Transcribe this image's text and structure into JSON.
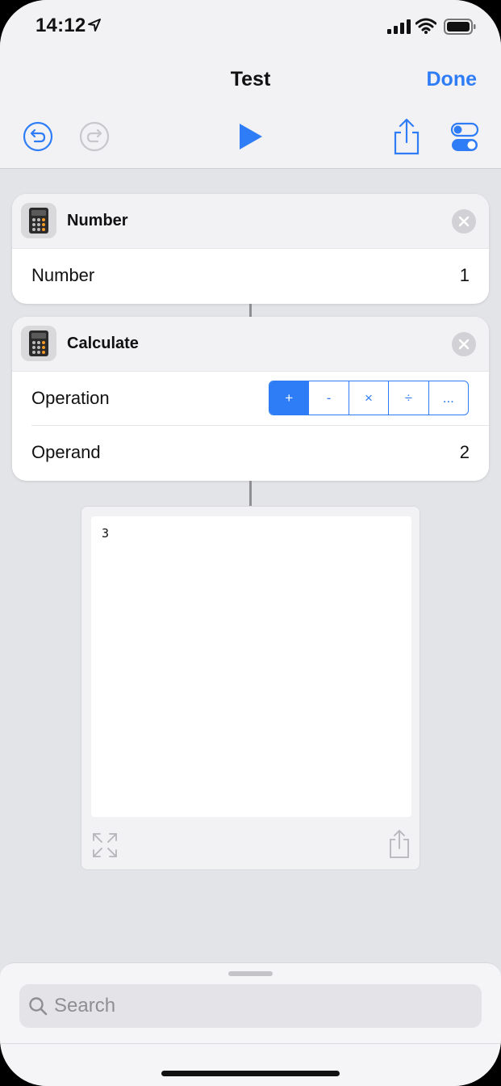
{
  "status_bar": {
    "time": "14:12"
  },
  "nav": {
    "title": "Test",
    "done_label": "Done"
  },
  "toolbar": {
    "icons": [
      "undo-icon",
      "redo-icon",
      "play-icon",
      "share-icon",
      "settings-toggle-icon"
    ]
  },
  "actions": [
    {
      "title": "Number",
      "icon": "calculator-icon",
      "rows": [
        {
          "label": "Number",
          "value": "1"
        }
      ]
    },
    {
      "title": "Calculate",
      "icon": "calculator-icon",
      "operation_label": "Operation",
      "operations": [
        "+",
        "-",
        "×",
        "÷",
        "..."
      ],
      "selected_operation": "+",
      "operand_label": "Operand",
      "operand_value": "2"
    }
  ],
  "result": {
    "text": "3"
  },
  "search": {
    "placeholder": "Search"
  },
  "colors": {
    "accent": "#2f7df6",
    "background": "#e3e4e7",
    "card": "#ffffff"
  }
}
